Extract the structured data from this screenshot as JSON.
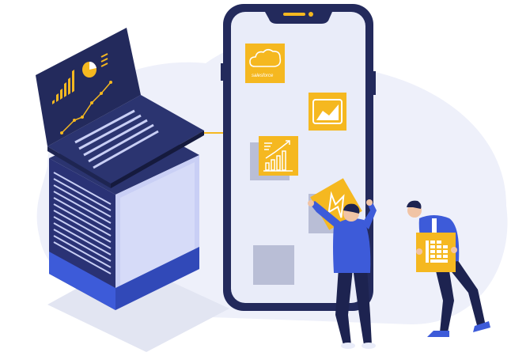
{
  "illustration": {
    "app_tiles": [
      {
        "name": "salesforce-tile",
        "label": "salesforce",
        "icon": "cloud-icon"
      },
      {
        "name": "line-chart-tile",
        "icon": "line-chart-icon"
      },
      {
        "name": "growth-chart-tile",
        "icon": "bar-chart-growth-icon"
      },
      {
        "name": "lightning-tile",
        "icon": "lightning-icon"
      },
      {
        "name": "spreadsheet-tile",
        "icon": "grid-table-icon"
      }
    ],
    "colors": {
      "accent": "#f5b820",
      "dark_navy": "#232a5c",
      "blue": "#3d5bd9",
      "phone_screen": "#e9ecf9",
      "blob": "#eef0fa",
      "placeholder": "#b9bed6",
      "server_side": "#c9cff5"
    }
  }
}
